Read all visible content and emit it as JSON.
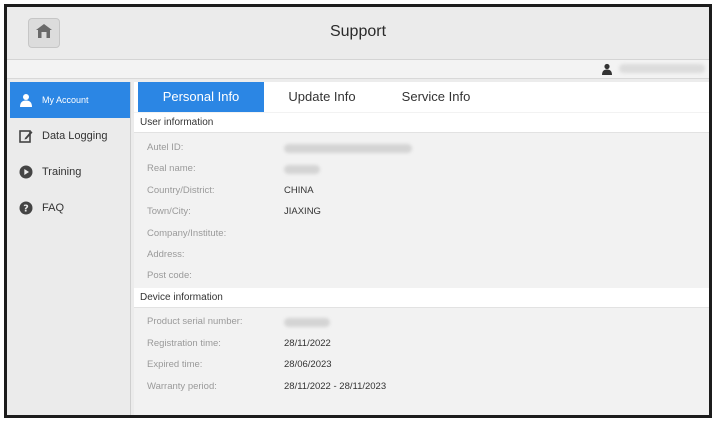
{
  "header": {
    "title": "Support",
    "home_icon": "home-icon"
  },
  "sidebar": {
    "items": [
      {
        "label": "My Account",
        "icon": "user-icon"
      },
      {
        "label": "Data Logging",
        "icon": "edit-icon"
      },
      {
        "label": "Training",
        "icon": "play-icon"
      },
      {
        "label": "FAQ",
        "icon": "help-icon"
      }
    ]
  },
  "tabs": [
    {
      "label": "Personal Info"
    },
    {
      "label": "Update Info"
    },
    {
      "label": "Service Info"
    }
  ],
  "user_info": {
    "heading": "User information",
    "rows": [
      {
        "label": "Autel ID:",
        "value": ""
      },
      {
        "label": "Real name:",
        "value": ""
      },
      {
        "label": "Country/District:",
        "value": "CHINA"
      },
      {
        "label": "Town/City:",
        "value": "JIAXING"
      },
      {
        "label": "Company/Institute:",
        "value": ""
      },
      {
        "label": "Address:",
        "value": ""
      },
      {
        "label": "Post code:",
        "value": ""
      }
    ]
  },
  "device_info": {
    "heading": "Device information",
    "rows": [
      {
        "label": "Product serial number:",
        "value": ""
      },
      {
        "label": "Registration time:",
        "value": "28/11/2022"
      },
      {
        "label": "Expired time:",
        "value": "28/06/2023"
      },
      {
        "label": "Warranty period:",
        "value": "28/11/2022 - 28/11/2023"
      }
    ]
  },
  "colors": {
    "accent": "#2b86e4",
    "background": "#f2f2f2"
  }
}
